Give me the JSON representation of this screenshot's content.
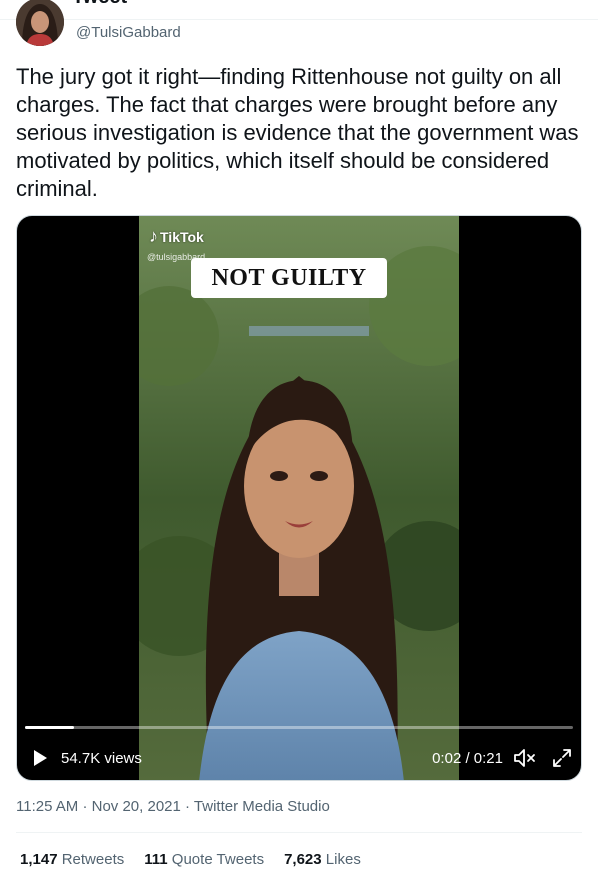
{
  "header": {
    "title": "Tweet"
  },
  "author": {
    "handle": "@TulsiGabbard"
  },
  "tweet": {
    "text": "The jury got it right—finding Rittenhouse not guilty on all charges. The fact that charges were brought before any serious investigation is evidence that the government was motivated by politics, which itself should be considered criminal."
  },
  "media": {
    "watermark": "TikTok",
    "watermark_handle": "@tulsigabbard",
    "overlay_text": "NOT GUILTY",
    "views": "54.7K views",
    "time": "0:02 / 0:21",
    "progress": 0.09,
    "icons": {
      "play": "play-icon",
      "mute": "mute-icon",
      "fullscreen": "fullscreen-icon"
    }
  },
  "meta": {
    "time": "11:25 AM",
    "date": "Nov 20, 2021",
    "separator": "·",
    "source": "Twitter Media Studio"
  },
  "stats": {
    "retweets_count": "1,147",
    "retweets_label": "Retweets",
    "quotes_count": "111",
    "quotes_label": "Quote Tweets",
    "likes_count": "7,623",
    "likes_label": "Likes"
  },
  "colors": {
    "text": "#0f1419",
    "secondary": "#536471",
    "divider": "#eff3f4"
  }
}
